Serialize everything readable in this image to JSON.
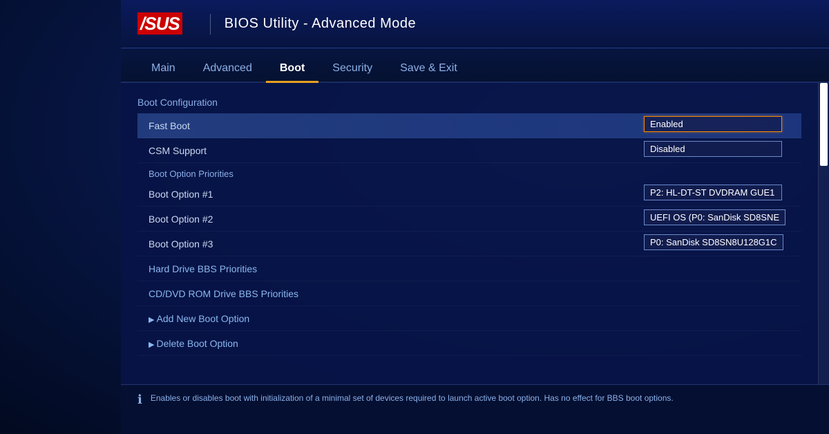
{
  "header": {
    "logo": "/SUS",
    "title": "BIOS Utility - Advanced Mode"
  },
  "nav": {
    "tabs": [
      {
        "id": "main",
        "label": "Main",
        "active": false
      },
      {
        "id": "advanced",
        "label": "Advanced",
        "active": false
      },
      {
        "id": "boot",
        "label": "Boot",
        "active": true
      },
      {
        "id": "security",
        "label": "Security",
        "active": false
      },
      {
        "id": "save-exit",
        "label": "Save & Exit",
        "active": false
      }
    ]
  },
  "content": {
    "section1_title": "Boot Configuration",
    "rows": [
      {
        "id": "fast-boot",
        "label": "Fast Boot",
        "value": "Enabled",
        "highlighted": true,
        "value_active": true
      },
      {
        "id": "csm-support",
        "label": "CSM Support",
        "value": "Disabled",
        "highlighted": false
      }
    ],
    "section2_title": "Boot Option Priorities",
    "boot_options": [
      {
        "id": "boot1",
        "label": "Boot Option #1",
        "value": "P2: HL-DT-ST DVDRAM GUE1"
      },
      {
        "id": "boot2",
        "label": "Boot Option #2",
        "value": "UEFI OS (P0: SanDisk SD8SNE"
      },
      {
        "id": "boot3",
        "label": "Boot Option #3",
        "value": "P0: SanDisk SD8SN8U128G1C"
      }
    ],
    "links": [
      {
        "id": "hdd-bbs",
        "label": "Hard Drive BBS Priorities"
      },
      {
        "id": "cddvd-bbs",
        "label": "CD/DVD ROM Drive BBS Priorities"
      }
    ],
    "expandables": [
      {
        "id": "add-boot",
        "label": "Add New Boot Option"
      },
      {
        "id": "delete-boot",
        "label": "Delete Boot Option"
      }
    ]
  },
  "footer": {
    "icon": "ℹ",
    "text": "Enables or disables boot with initialization of a minimal set of devices required to launch active boot option. Has no effect for BBS boot options."
  }
}
